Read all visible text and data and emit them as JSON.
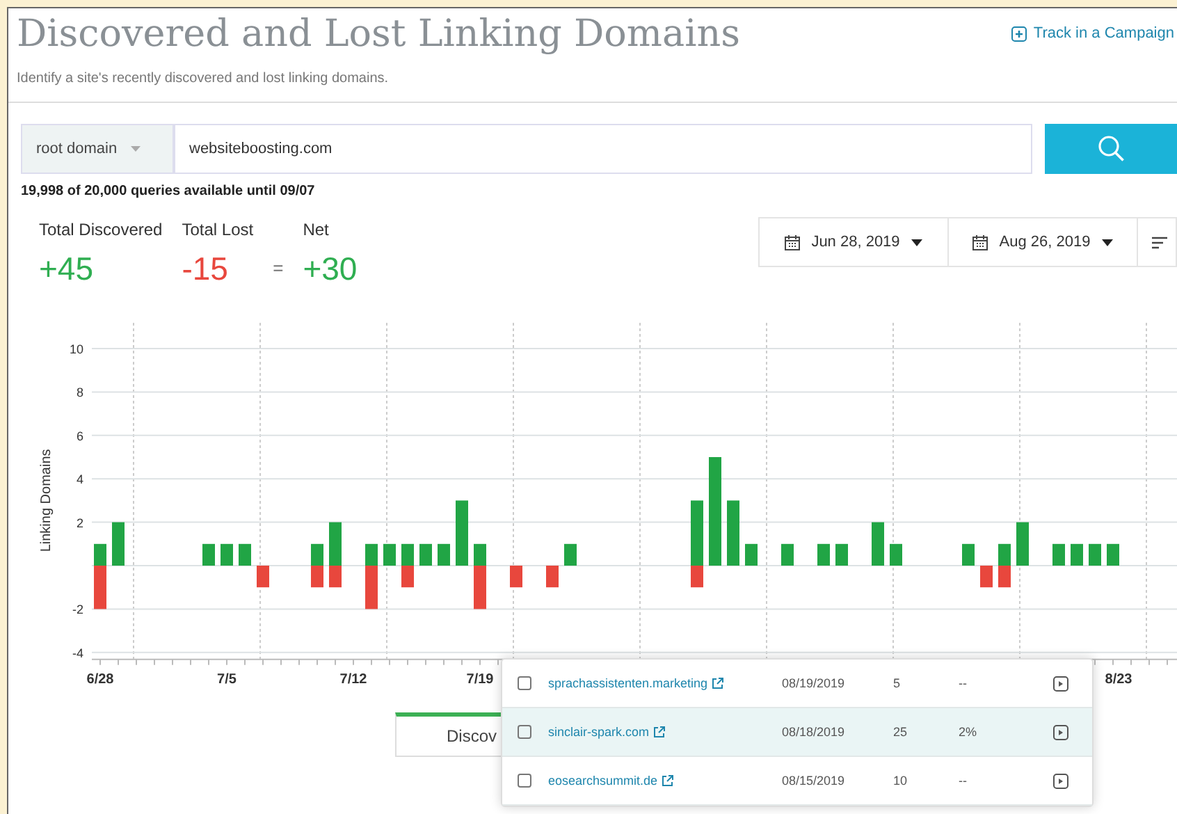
{
  "header": {
    "title": "Discovered and Lost Linking Domains",
    "subtitle": "Identify a site's recently discovered and lost linking domains.",
    "track_link": "Track in a Campaign"
  },
  "search": {
    "scope": "root domain",
    "value": "websiteboosting.com"
  },
  "quota": "19,998 of 20,000 queries available until 09/07",
  "metrics": [
    {
      "label": "Total Discovered",
      "value": "+45",
      "kind": "gain"
    },
    {
      "label": "Total Lost",
      "value": "-15",
      "kind": "loss"
    },
    {
      "label": "Net",
      "value": "+30",
      "kind": "gain"
    }
  ],
  "metric_operator": "=",
  "date_range": [
    {
      "label": "Jun 28, 2019"
    },
    {
      "label": "Aug 26, 2019"
    }
  ],
  "chart_data": {
    "type": "bar",
    "stacked": true,
    "grid": true,
    "ylabel": "Linking Domains",
    "ylim": [
      -4,
      10
    ],
    "yticks": [
      -4,
      -2,
      2,
      4,
      6,
      8,
      10
    ],
    "categories": [
      "6/28",
      null,
      null,
      null,
      null,
      null,
      null,
      "7/5",
      null,
      null,
      null,
      null,
      null,
      null,
      "7/12",
      null,
      null,
      null,
      null,
      null,
      null,
      "7/19",
      null,
      null,
      null,
      null,
      null,
      null,
      null,
      null,
      null,
      null,
      null,
      null,
      null,
      null,
      null,
      null,
      null,
      null,
      null,
      null,
      null,
      null,
      null,
      null,
      null,
      null,
      null,
      null,
      null,
      null,
      null,
      null,
      null,
      null,
      "8/23",
      null,
      null,
      null
    ],
    "series": [
      {
        "color": "#21a545",
        "values": [
          1,
          2,
          0,
          0,
          0,
          0,
          1,
          1,
          1,
          0,
          0,
          0,
          1,
          2,
          0,
          1,
          1,
          1,
          1,
          1,
          3,
          1,
          0,
          0,
          0,
          0,
          1,
          0,
          0,
          0,
          0,
          0,
          0,
          3,
          5,
          3,
          1,
          0,
          1,
          0,
          1,
          1,
          0,
          2,
          1,
          0,
          0,
          0,
          1,
          0,
          1,
          2,
          0,
          1,
          1,
          1,
          1,
          0,
          0,
          0
        ]
      },
      {
        "color": "#e8473d",
        "values": [
          -2,
          0,
          0,
          0,
          0,
          0,
          0,
          0,
          0,
          -1,
          0,
          0,
          -1,
          -1,
          0,
          -2,
          0,
          -1,
          0,
          0,
          0,
          -2,
          0,
          -1,
          0,
          -1,
          0,
          0,
          0,
          0,
          0,
          0,
          0,
          -1,
          0,
          0,
          0,
          0,
          0,
          0,
          0,
          0,
          0,
          0,
          0,
          0,
          0,
          0,
          0,
          -1,
          -1,
          0,
          0,
          0,
          0,
          0,
          0,
          0,
          0,
          0
        ]
      }
    ]
  },
  "tabs": [
    {
      "label": "Discov",
      "selected": true
    }
  ],
  "popup": {
    "rows": [
      {
        "domain": "sprachassistenten.marketing",
        "date": "08/19/2019",
        "count": "5",
        "share": "--",
        "checked": false,
        "selected": false
      },
      {
        "domain": "sinclair-spark.com",
        "date": "08/18/2019",
        "count": "25",
        "share": "2%",
        "checked": false,
        "selected": true
      },
      {
        "domain": "eosearchsummit.de",
        "date": "08/15/2019",
        "count": "10",
        "share": "--",
        "checked": false,
        "selected": false
      }
    ]
  }
}
